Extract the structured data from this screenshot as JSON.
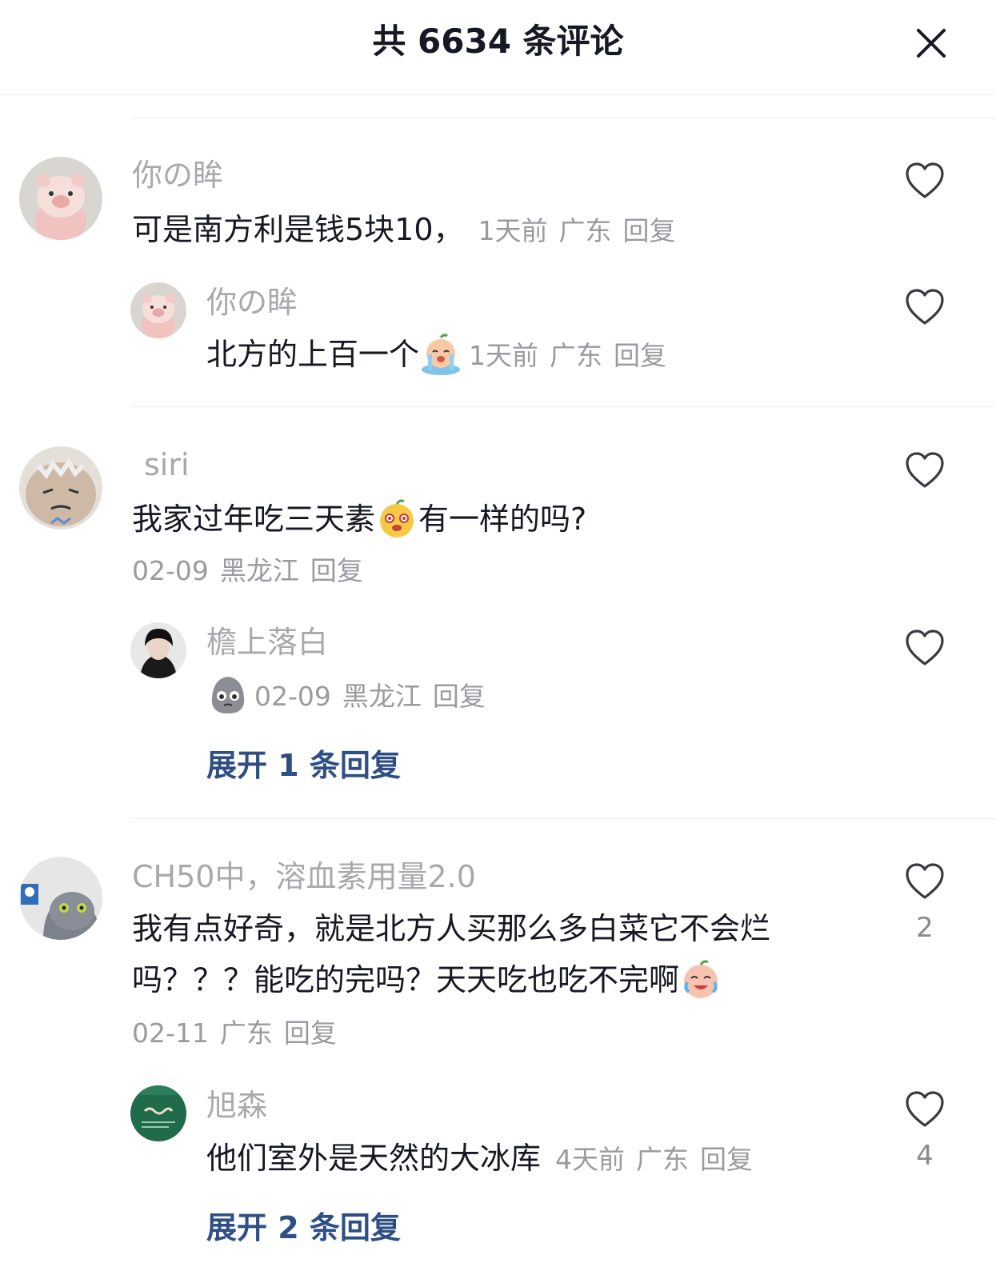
{
  "header": {
    "title": "共 6634 条评论"
  },
  "comments": [
    {
      "name": "你の眸",
      "text": "可是南方利是钱5块10，",
      "time": "1天前",
      "location": "广东",
      "reply": "回复",
      "reply_item": {
        "name": "你の眸",
        "text": "北方的上百一个",
        "time": "1天前",
        "location": "广东",
        "reply": "回复"
      }
    },
    {
      "name": "siri",
      "text_a": "我家过年吃三天素",
      "text_b": "有一样的吗?",
      "time": "02-09",
      "location": "黑龙江",
      "reply": "回复",
      "reply_item": {
        "name": "檐上落白",
        "time": "02-09",
        "location": "黑龙江",
        "reply": "回复"
      },
      "expand": "展开 1 条回复"
    },
    {
      "name": "CH50中，溶血素用量2.0",
      "line1": "我有点好奇，就是北方人买那么多白菜它不会烂",
      "line2": "吗？？？能吃的完吗？天天吃也吃不完啊",
      "time": "02-11",
      "location": "广东",
      "reply": "回复",
      "likes": "2",
      "reply_item": {
        "name": "旭森",
        "text": "他们室外是天然的大冰库",
        "time": "4天前",
        "location": "广东",
        "reply": "回复",
        "likes": "4"
      },
      "expand": "展开 2 条回复"
    }
  ],
  "icons": {
    "close": "close-icon",
    "like": "heart-icon"
  }
}
